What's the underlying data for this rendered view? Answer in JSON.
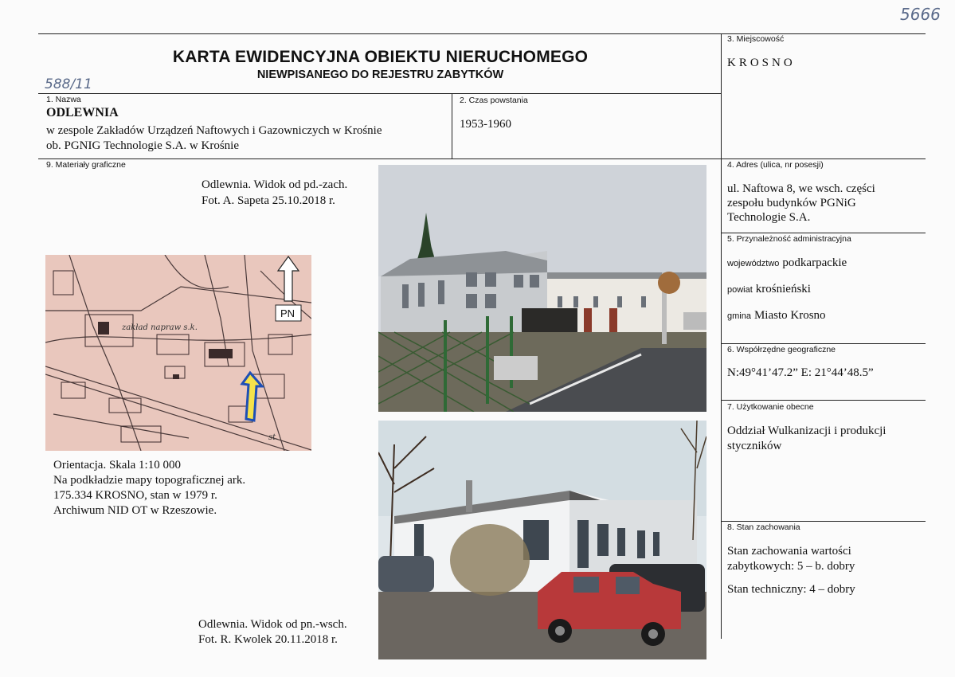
{
  "archive_number": "5666",
  "inventory_number": "588/11",
  "header": {
    "title": "KARTA EWIDENCYJNA OBIEKTU NIERUCHOMEGO",
    "subtitle": "NIEWPISANEGO DO REJESTRU ZABYTKÓW"
  },
  "fields": {
    "name": {
      "label": "1. Nazwa",
      "title": "ODLEWNIA",
      "line1": "w zespole Zakładów Urządzeń Naftowych i Gazowniczych w  Krośnie",
      "line2": "ob. PGNIG Technologie S.A. w Krośnie"
    },
    "date": {
      "label": "2. Czas powstania",
      "value": "1953-1960"
    },
    "place": {
      "label": "3. Miejscowość",
      "value": "KROSNO"
    },
    "address": {
      "label": "4. Adres (ulica, nr posesji)",
      "line1": "ul. Naftowa 8, we wsch. części",
      "line2": "zespołu budynków PGNiG",
      "line3": "Technologie S.A."
    },
    "admin": {
      "label": "5. Przynależność administracyjna",
      "voiv_label": "województwo",
      "voiv_value": "podkarpackie",
      "county_label": "powiat",
      "county_value": "krośnieński",
      "commune_label": "gmina",
      "commune_value": "Miasto Krosno"
    },
    "coords": {
      "label": "6. Współrzędne geograficzne",
      "value": "N:49°41’47.2” E: 21°44’48.5”"
    },
    "use": {
      "label": "7. Użytkowanie obecne",
      "line1": "Oddział Wulkanizacji i produkcji",
      "line2": "styczników"
    },
    "condition": {
      "label": "8. Stan zachowania",
      "line1": "Stan zachowania wartości",
      "line2": "zabytkowych: 5 – b. dobry",
      "line3": "Stan techniczny: 4 – dobry"
    },
    "graphics": {
      "label": "9. Materiały graficzne"
    }
  },
  "captions": {
    "photo1_line1": "Odlewnia. Widok od pd.-zach.",
    "photo1_line2": "Fot. A. Sapeta 25.10.2018 r.",
    "map_line1": "Orientacja. Skala 1:10 000",
    "map_line2": "Na podkładzie mapy topograficznej ark.",
    "map_line3": "175.334 KROSNO, stan w 1979 r.",
    "map_line4": "Archiwum NID OT w Rzeszowie.",
    "photo2_line1": "Odlewnia. Widok od pn.-wsch.",
    "photo2_line2": "Fot. R. Kwolek 20.11.2018 r."
  },
  "map": {
    "north_label": "PN",
    "text1": "zakład napraw s.k.",
    "text2": "st."
  }
}
